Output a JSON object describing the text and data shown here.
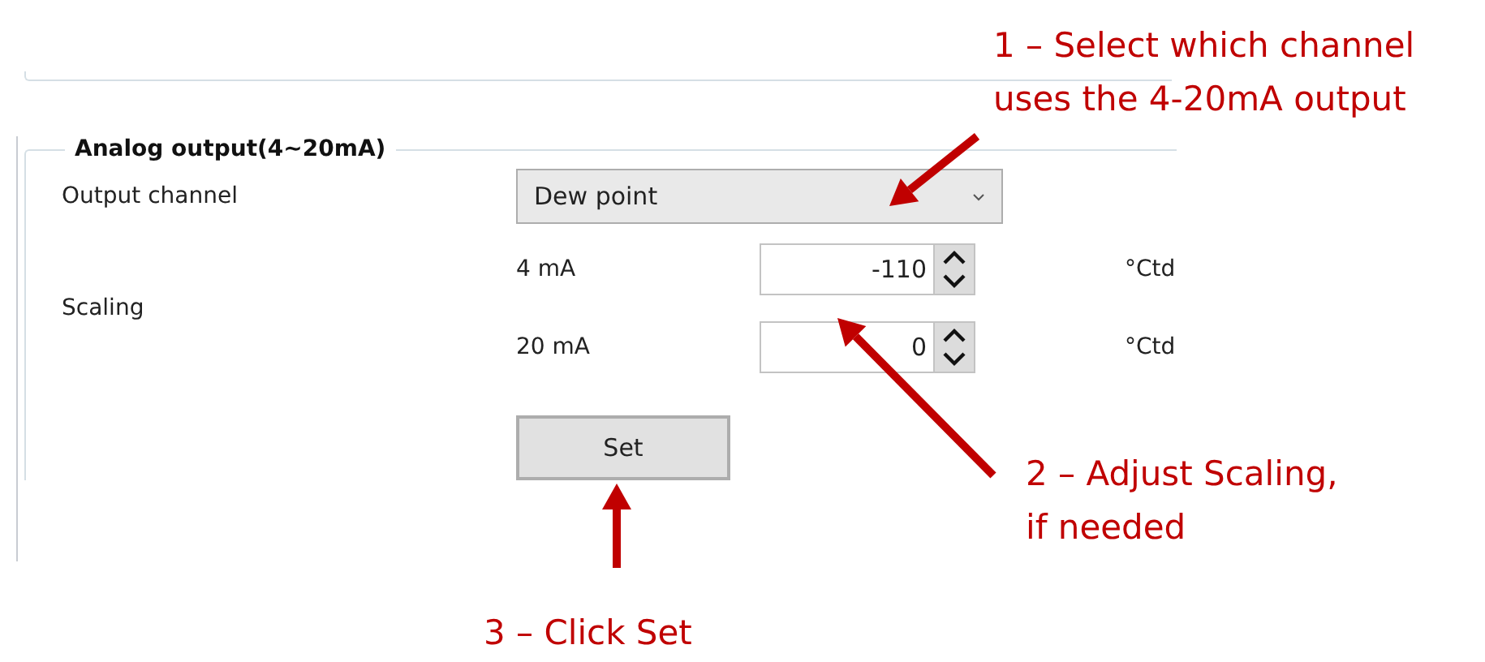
{
  "group": {
    "title": "Analog output(4~20mA)",
    "output_channel": {
      "label": "Output channel",
      "value": "Dew point"
    },
    "scaling": {
      "label": "Scaling",
      "rows": [
        {
          "label": "4 mA",
          "value": "-110",
          "unit": "°Ctd"
        },
        {
          "label": "20 mA",
          "value": "0",
          "unit": "°Ctd"
        }
      ]
    },
    "set_button": "Set"
  },
  "annotations": [
    {
      "text": "1 – Select which channel\nuses the 4-20mA output"
    },
    {
      "text": "2 – Adjust Scaling,\nif needed"
    },
    {
      "text": "3 – Click Set"
    }
  ]
}
